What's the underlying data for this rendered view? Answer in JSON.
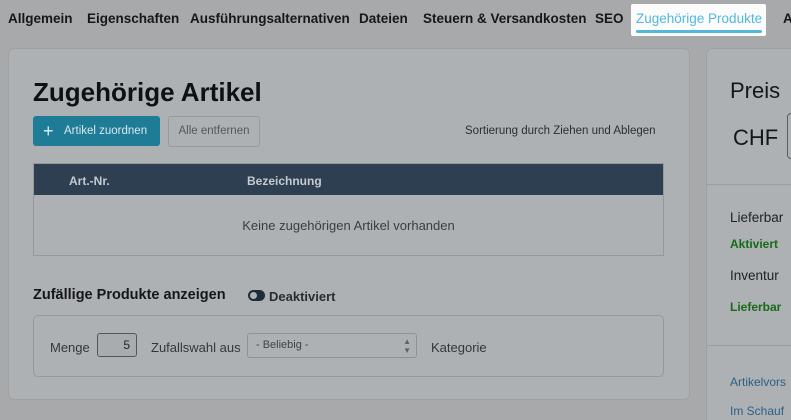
{
  "tabs": [
    {
      "label": "Allgemein",
      "active": false
    },
    {
      "label": "Eigenschaften",
      "active": false
    },
    {
      "label": "Ausführungsalternativen",
      "active": false
    },
    {
      "label": "Dateien",
      "active": false
    },
    {
      "label": "Steuern & Versandkosten",
      "active": false
    },
    {
      "label": "SEO",
      "active": false
    },
    {
      "label": "Zugehörige Produkte",
      "active": true
    },
    {
      "label": "A",
      "active": false
    }
  ],
  "related": {
    "title": "Zugehörige Artikel",
    "assign_button": "Artikel zuordnen",
    "remove_all_button": "Alle entfernen",
    "sort_hint": "Sortierung durch Ziehen und Ablegen",
    "table": {
      "columns": [
        "Art.-Nr.",
        "Bezeichnung"
      ],
      "empty_text": "Keine zugehörigen Artikel vorhanden"
    }
  },
  "random_products": {
    "title": "Zufällige Produkte anzeigen",
    "toggle_state": "Deaktiviert",
    "quantity_label": "Menge",
    "quantity_value": "5",
    "random_from_label": "Zufallswahl aus",
    "select_value": "- Beliebig -",
    "category_label": "Kategorie"
  },
  "side_panel": {
    "title": "Preis",
    "currency": "CHF",
    "availability_label": "Lieferbar",
    "availability_value": "Aktiviert",
    "inventory_label": "Inventur",
    "inventory_value": "Lieferbar",
    "link_preview": "Artikelvors",
    "link_shop": "Im Schauf"
  },
  "colors": {
    "accent": "#52b8dc",
    "primary_button": "#1f7c97",
    "table_header": "#2d3f50",
    "status_green": "#176a17",
    "link": "#2c5f86"
  },
  "icons": {
    "add": "plus-icon",
    "toggle": "toggle-off-icon",
    "select": "updown-chevron-icon"
  }
}
